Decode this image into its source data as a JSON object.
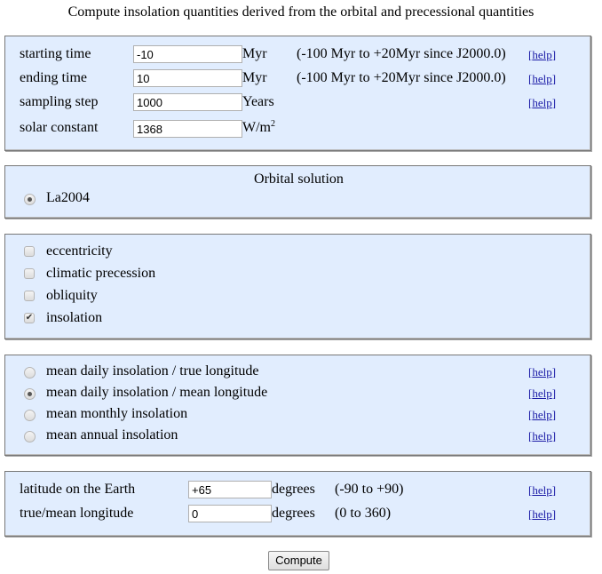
{
  "page": {
    "title": "Compute insolation quantities derived from the orbital and precessional quantities"
  },
  "time_params": {
    "rows": [
      {
        "label": "starting time",
        "value": "-10",
        "unit": "Myr",
        "range": "(-100 Myr to +20Myr since J2000.0)",
        "help": "help"
      },
      {
        "label": "ending time",
        "value": "10",
        "unit": "Myr",
        "range": "(-100 Myr to +20Myr since J2000.0)",
        "help": "help"
      },
      {
        "label": "sampling step",
        "value": "1000",
        "unit": "Years",
        "range": "",
        "help": "help"
      },
      {
        "label": "solar constant",
        "value": "1368",
        "unit": "W/m",
        "unit_sup": "2",
        "range": "",
        "help": ""
      }
    ]
  },
  "orbital_solution": {
    "heading": "Orbital solution",
    "options": [
      {
        "label": "La2004",
        "selected": true
      }
    ]
  },
  "quantities": {
    "options": [
      {
        "label": "eccentricity",
        "checked": false
      },
      {
        "label": "climatic precession",
        "checked": false
      },
      {
        "label": "obliquity",
        "checked": false
      },
      {
        "label": "insolation",
        "checked": true
      }
    ],
    "check_glyph": "✔"
  },
  "insolation_type": {
    "options": [
      {
        "label": "mean daily insolation / true longitude",
        "selected": false,
        "help": "help"
      },
      {
        "label": "mean daily insolation / mean longitude",
        "selected": true,
        "help": "help"
      },
      {
        "label": "mean monthly insolation",
        "selected": false,
        "help": "help"
      },
      {
        "label": "mean annual insolation",
        "selected": false,
        "help": "help"
      }
    ]
  },
  "location": {
    "rows": [
      {
        "label": "latitude on the Earth",
        "value": "+65",
        "unit": "degrees",
        "range": "(-90 to +90)",
        "help": "help"
      },
      {
        "label": "true/mean longitude",
        "value": "0",
        "unit": "degrees",
        "range": "(0 to 360)",
        "help": "help"
      }
    ]
  },
  "submit": {
    "label": "Compute"
  },
  "bracket_open": "[",
  "bracket_close": "]"
}
